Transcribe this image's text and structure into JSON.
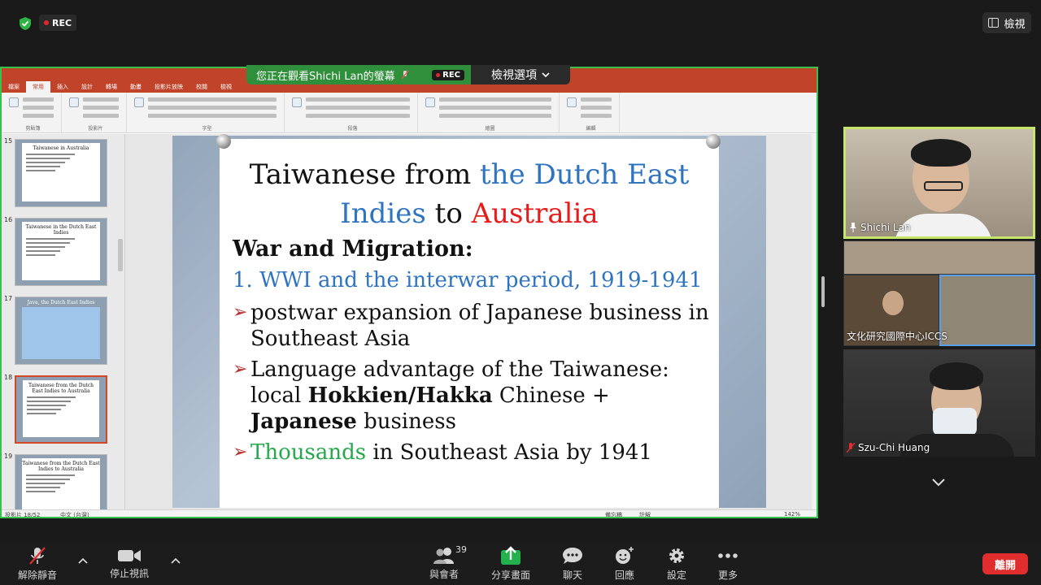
{
  "top_bar": {
    "rec_label": "REC",
    "view_button_label": "檢視"
  },
  "share": {
    "banner_text": "您正在觀看Shichi Lan的螢幕",
    "rec_label": "REC",
    "view_options_label": "檢視選項"
  },
  "powerpoint": {
    "tabs": [
      "檔案",
      "常用",
      "插入",
      "設計",
      "轉場",
      "動畫",
      "投影片放映",
      "校閱",
      "檢視"
    ],
    "active_tab": "常用",
    "ribbon_groups": [
      "剪貼簿",
      "投影片",
      "字型",
      "段落",
      "繪圖",
      "編輯"
    ],
    "status": {
      "slide_counter": "投影片 18/52",
      "language": "中文 (台灣)",
      "notes": "備忘稿",
      "comments": "註解",
      "zoom": "142%"
    },
    "thumbnails": [
      {
        "number": "15",
        "title": "Taiwanese in Australia"
      },
      {
        "number": "16",
        "title": "Taiwanese in the Dutch East Indies"
      },
      {
        "number": "17",
        "title": "Java, the Dutch East Indies"
      },
      {
        "number": "18",
        "title": "Taiwanese from the Dutch East Indies to Australia"
      },
      {
        "number": "19",
        "title": "Taiwanese from the Dutch East Indies to Australia"
      }
    ]
  },
  "slide": {
    "title_part1": "Taiwanese from ",
    "title_part2": "the Dutch East",
    "title_part3": "Indies",
    "title_part4": " to ",
    "title_part5": "Australia",
    "heading": "War and Migration:",
    "numbered": "1. WWI and the interwar period, 1919-1941",
    "bullet1": "postwar expansion of Japanese business in Southeast Asia",
    "bullet2_a": "Language advantage of the Taiwanese: local ",
    "bullet2_b": "Hokkien/Hakka",
    "bullet2_c": " Chinese + ",
    "bullet2_d": "Japanese",
    "bullet2_e": " business",
    "bullet3_a": "Thousands",
    "bullet3_b": " in Southeast Asia by 1941"
  },
  "participants": [
    {
      "name": "Shichi Lan"
    },
    {
      "name": "文化研究國際中心ICCS"
    },
    {
      "name": "Szu-Chi Huang"
    }
  ],
  "toolbar": {
    "unmute": "解除靜音",
    "stop_video": "停止視訊",
    "participants": "與會者",
    "participants_count": "39",
    "share_screen": "分享畫面",
    "chat": "聊天",
    "reactions": "回應",
    "settings": "設定",
    "more": "更多",
    "leave": "離開"
  },
  "colors": {
    "share_border": "#36c24c",
    "leave": "#e02d2d",
    "ppt_accent": "#c0432a",
    "active_speaker": "#c7e56a"
  }
}
